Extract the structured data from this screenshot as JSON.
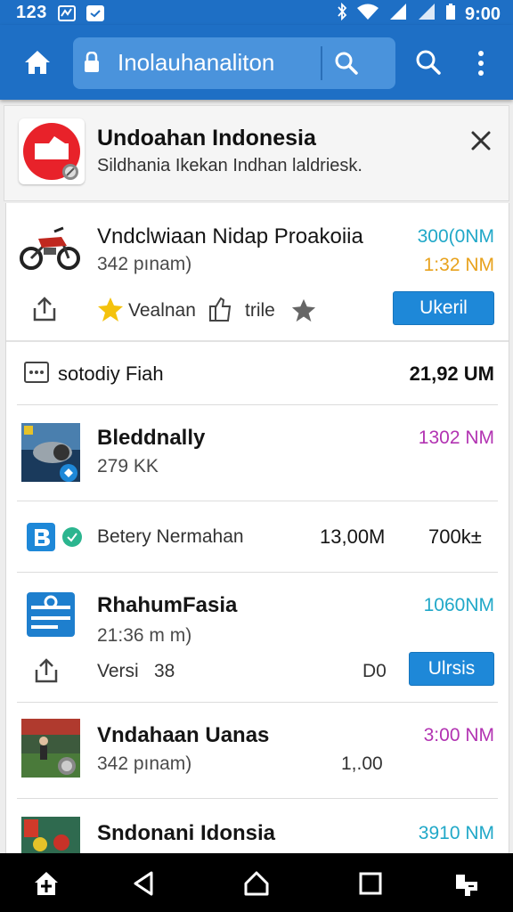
{
  "status_bar": {
    "left_text": "123",
    "time": "9:00"
  },
  "app_bar": {
    "url": "Inolauhanaliton"
  },
  "banner": {
    "title": "Undoahan Indonesia",
    "subtitle": "Sildhania Ikekan Indhan laldriesk."
  },
  "items": [
    {
      "title": "Vndclwiaan Nidap Proakoiia",
      "meta": "342 pınam)",
      "size1": "300(0NM",
      "size2": "1:32 NM",
      "action1": "Vealnan",
      "action2": "trile",
      "button": "Ukeril"
    },
    {
      "title": "sotodiy Fiah",
      "size": "21,92 UM"
    },
    {
      "title": "Bleddnally",
      "meta": "279 KK",
      "size": "1302 NM"
    },
    {
      "title": "Betery Nermahan",
      "col1": "13,00M",
      "col2": "700k±"
    },
    {
      "title": "RhahumFasia",
      "meta": "21:36 m m)",
      "version_label": "Versi",
      "version": "38",
      "status": "D0",
      "button": "Ulrsis",
      "size": "1060NM"
    },
    {
      "title": "Vndahaan Uanas",
      "meta": "342 pınam)",
      "mid": "1,.00",
      "size": "3:00 NM"
    },
    {
      "title": "Sndonani Idonsia",
      "size": "3910 NM"
    }
  ],
  "colors": {
    "primary": "#1e6fc5",
    "url_box": "#4a93dc",
    "button": "#1e88d8",
    "teal_size": "#21a8c8",
    "orange_size": "#e8a21d",
    "magenta_size": "#b233b2",
    "star": "#f4c20d"
  }
}
